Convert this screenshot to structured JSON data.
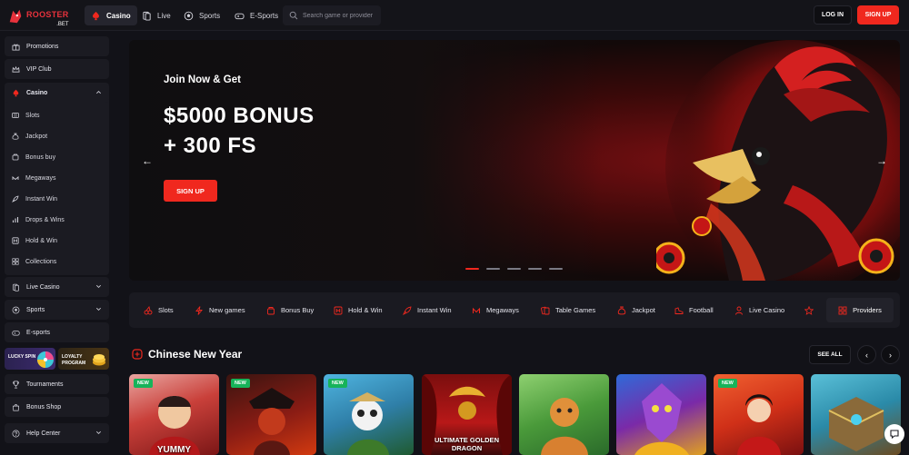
{
  "brand": {
    "name": "ROOSTER",
    "sub": ".BET"
  },
  "topnav": {
    "items": [
      "Casino",
      "Live",
      "Sports",
      "E-Sports"
    ],
    "search_placeholder": "Search game or provider",
    "login_label": "LOG IN",
    "signup_label": "SIGN UP"
  },
  "sidebar": {
    "promotions": "Promotions",
    "vip": "VIP Club",
    "casino": "Casino",
    "casino_sub": [
      "Slots",
      "Jackpot",
      "Bonus buy",
      "Megaways",
      "Instant Win",
      "Drops & Wins",
      "Hold & Win",
      "Collections"
    ],
    "live_casino": "Live Casino",
    "sports": "Sports",
    "esports": "E-sports",
    "tile_spin": "LUCKY SPIN",
    "tile_loyalty_1": "LOYALTY",
    "tile_loyalty_2": "PROGRAM",
    "tournaments": "Tournaments",
    "bonus_shop": "Bonus Shop",
    "help": "Help Center"
  },
  "banner": {
    "subtitle": "Join Now & Get",
    "title_line1": "$5000 BONUS",
    "title_line2": "+ 300 FS",
    "cta": "SIGN UP",
    "slides": 5,
    "active_slide": 1
  },
  "categories": [
    "Slots",
    "New games",
    "Bonus Buy",
    "Hold & Win",
    "Instant Win",
    "Megaways",
    "Table Games",
    "Jackpot",
    "Football",
    "Live Casino"
  ],
  "providers_label": "Providers",
  "section": {
    "title": "Chinese New Year",
    "see_all": "SEE ALL"
  },
  "games": [
    {
      "badge": "NEW",
      "caption": "YUMMY"
    },
    {
      "badge": "NEW",
      "caption": ""
    },
    {
      "badge": "NEW",
      "caption": ""
    },
    {
      "badge": "",
      "caption": "ULTIMATE GOLDEN DRAGON"
    },
    {
      "badge": "",
      "caption": ""
    },
    {
      "badge": "",
      "caption": ""
    },
    {
      "badge": "NEW",
      "caption": ""
    },
    {
      "badge": "",
      "caption": ""
    }
  ],
  "colors": {
    "accent": "#f0281e",
    "bg": "#121218",
    "panel": "#1b1b22",
    "badge": "#17b35a"
  }
}
